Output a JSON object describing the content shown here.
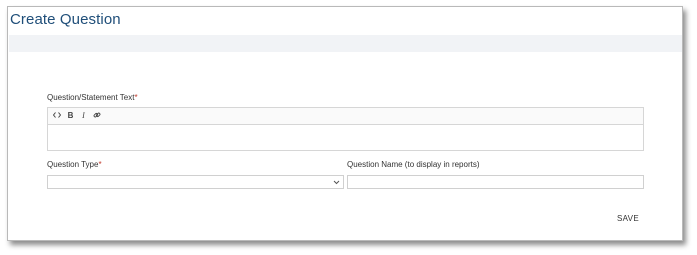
{
  "page": {
    "title": "Create Question"
  },
  "form": {
    "question_text_label": "Question/Statement Text",
    "required_marker": "*",
    "toolbar": {
      "code_icon": "code-icon",
      "bold_glyph": "B",
      "italic_glyph": "I",
      "link_icon": "link-icon"
    },
    "question_text_value": "",
    "question_type_label": "Question Type",
    "question_type_value": "",
    "question_name_label": "Question Name (to display in reports)",
    "question_name_value": ""
  },
  "actions": {
    "save_label": "SAVE"
  },
  "colors": {
    "title": "#1f4e79",
    "required": "#c0392b",
    "band": "#f1f3f6"
  }
}
